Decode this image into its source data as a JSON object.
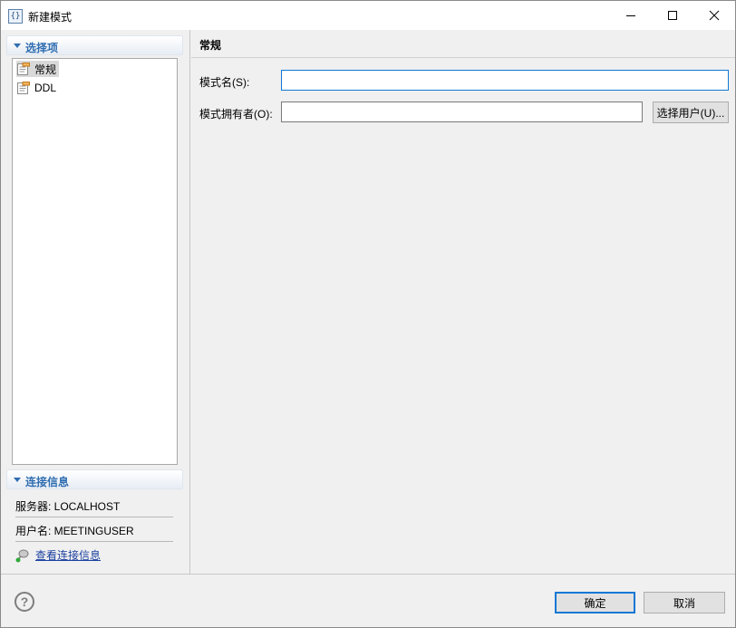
{
  "window": {
    "title": "新建模式",
    "app_icon_glyph": "{}"
  },
  "left": {
    "options_header": "选择项",
    "tree_items": [
      {
        "label": "常规",
        "icon": "page-folder-icon",
        "selected": true
      },
      {
        "label": "DDL",
        "icon": "page-folder-icon",
        "selected": false
      }
    ],
    "connection_header": "连接信息",
    "server": "服务器: LOCALHOST",
    "user": "用户名: MEETINGUSER",
    "view_link": "查看连接信息"
  },
  "main": {
    "section_title": "常规",
    "schema_name": {
      "label": "模式名(S):",
      "value": ""
    },
    "owner": {
      "label": "模式拥有者(O):",
      "value": ""
    },
    "select_user_button": "选择用户(U)..."
  },
  "footer": {
    "ok": "确定",
    "cancel": "取消",
    "help_glyph": "?"
  },
  "colors": {
    "accent": "#2f6db0",
    "focus": "#0f78d4",
    "link": "#1a3fa0"
  }
}
